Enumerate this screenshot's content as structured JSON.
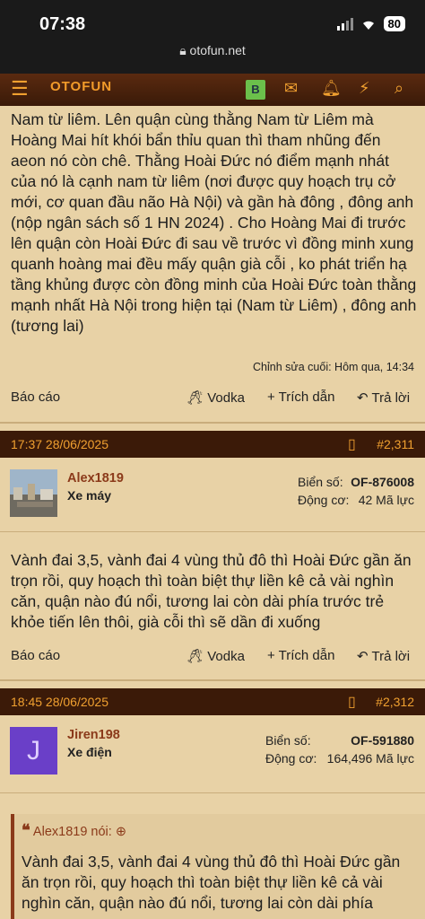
{
  "status": {
    "time": "07:38",
    "battery": "80",
    "url": "otofun.net"
  },
  "nav": {
    "logo": "OTOFUN",
    "badge": "B"
  },
  "post1": {
    "text": "Nam từ liêm. Lên quận cùng thằng Nam từ Liêm mà Hoàng Mai hít khói bẩn thỉu quan thì tham nhũng đến aeon nó còn chê. Thằng Hoài Đức nó điểm mạnh nhát của nó là cạnh nam từ liêm (nơi được quy hoạch trụ cở mới, cơ quan đầu não Hà Nội) và gần hà đông , đông anh (nộp ngân sách số 1 HN 2024) . Cho Hoàng Mai đi trước lên quận còn Hoài Đức đi sau về trước vì đồng minh xung quanh hoàng mai đều mấy quận già cỗi , ko phát triển hạ tầng khủng được còn đồng minh của Hoài Đức toàn thằng mạnh nhất Hà Nội trong hiện tại (Nam từ Liêm) , đông anh (tương lai)",
    "edited": "Chỉnh sửa cuối: Hôm qua, 14:34"
  },
  "actions": {
    "report": "Báo cáo",
    "vodka": "Vodka",
    "quote": "+ Trích dẫn",
    "reply": "Trả lời"
  },
  "post2": {
    "datetime": "17:37 28/06/2025",
    "number": "#2,311",
    "user": "Alex1819",
    "rank": "Xe máy",
    "plate_label": "Biển số:",
    "plate": "OF-876008",
    "engine_label": "Động cơ:",
    "engine": "42 Mã lực",
    "text": "Vành đai 3,5, vành đai 4 vùng thủ đô thì Hoài Đức gần ăn trọn rồi, quy hoạch thì toàn biệt thự liền kê cả vài nghìn căn, quận nào đú nổi, tương lai còn dài phía trước trẻ khỏe tiến lên thôi, già cỗi thì sẽ dần đi xuống"
  },
  "post3": {
    "datetime": "18:45 28/06/2025",
    "number": "#2,312",
    "user": "Jiren198",
    "avatar_letter": "J",
    "rank": "Xe điện",
    "plate_label": "Biển số:",
    "plate": "OF-591880",
    "engine_label": "Động cơ:",
    "engine": "164,496 Mã lực",
    "quote_author": "Alex1819 nói:",
    "quote_text": "Vành đai 3,5, vành đai 4 vùng thủ đô thì Hoài Đức gần ăn trọn rồi, quy hoạch thì toàn biệt thự liền kê cả vài nghìn căn, quận nào đú nổi, tương lai còn dài phía"
  },
  "colors": {
    "accent": "#f0a030",
    "header": "#3b1a08",
    "bg": "#e8d2a6",
    "username": "#8b3a1a",
    "avatar": "#6a3fc8"
  }
}
